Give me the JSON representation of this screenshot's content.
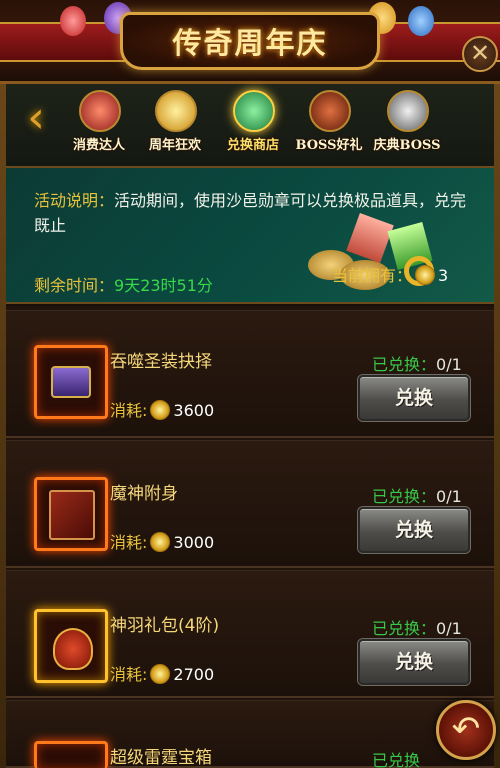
{
  "header": {
    "title": "传奇周年庆",
    "close_icon": "close-icon"
  },
  "tabs": [
    {
      "label": "消费达人",
      "icon": "gift-chest-icon",
      "color": "#b02a2a"
    },
    {
      "label": "周年狂欢",
      "icon": "star-badge-icon",
      "color": "#e8b020"
    },
    {
      "label": "兑换商店",
      "icon": "jade-exchange-icon",
      "color": "#2a9a4a",
      "active": true
    },
    {
      "label": "BOSS好礼",
      "icon": "boss-mask-icon",
      "color": "#8a2a10"
    },
    {
      "label": "庆典BOSS",
      "icon": "skull-helm-icon",
      "color": "#a0a0a0"
    }
  ],
  "info": {
    "desc_label": "活动说明：",
    "desc_text": "活动期间，使用沙邑勋章可以兑换极品道具，兑完既止",
    "remain_label": "剩余时间：",
    "remain_value": "9天23时51分",
    "owned_label": "当前拥有：",
    "owned_value": "3"
  },
  "items": [
    {
      "name": "吞噬圣装抉择",
      "cost_label": "消耗:",
      "cost": "3600",
      "status_label": "已兑换：",
      "status_value": "0/1",
      "button": "兑换",
      "icon": "treasure-chest-icon"
    },
    {
      "name": "魔神附身",
      "cost_label": "消耗:",
      "cost": "3000",
      "status_label": "已兑换：",
      "status_value": "0/1",
      "button": "兑换",
      "icon": "spell-book-icon"
    },
    {
      "name": "神羽礼包(4阶)",
      "cost_label": "消耗:",
      "cost": "2700",
      "status_label": "已兑换：",
      "status_value": "0/1",
      "button": "兑换",
      "icon": "coin-bag-icon"
    },
    {
      "name": "超级雷霆宝箱",
      "cost_label": "",
      "cost": "",
      "status_label": "已兑换",
      "status_value": "",
      "button": "",
      "icon": "thunder-box-icon"
    }
  ],
  "back_icon": "back-arrow-icon"
}
